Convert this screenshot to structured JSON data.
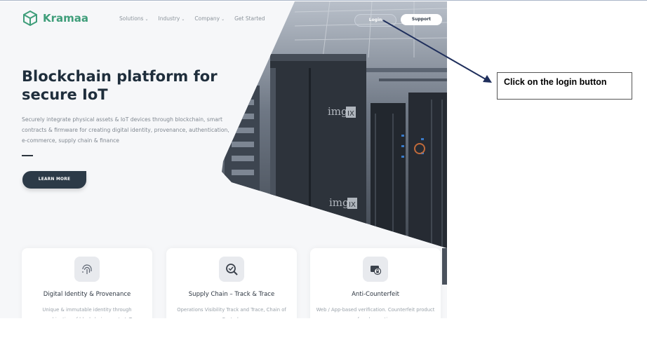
{
  "site": {
    "brand": "Kramaa",
    "nav": [
      {
        "label": "Solutions",
        "has_dropdown": true
      },
      {
        "label": "Industry",
        "has_dropdown": true
      },
      {
        "label": "Company",
        "has_dropdown": true
      },
      {
        "label": "Get Started",
        "has_dropdown": false
      }
    ],
    "login_label": "Login",
    "support_label": "Support",
    "hero": {
      "headline": "Blockchain platform for secure IoT",
      "subtext": "Securely integrate physical assets & IoT devices through blockchain, smart contracts & firmware for creating digital identity, provenance, authentication, e-commerce, supply chain & finance",
      "cta_label": "LEARN MORE",
      "image_watermark": "imgIX"
    },
    "cards": [
      {
        "title": "Digital Identity & Provenance",
        "desc": "Unique & immutable identity through combination of blockchain, crypto IoT",
        "icon": "fingerprint-icon"
      },
      {
        "title": "Supply Chain – Track & Trace",
        "desc": "Operations Visibility Track and Trace, Chain of Custody",
        "icon": "search-check-icon"
      },
      {
        "title": "Anti-Counterfeit",
        "desc": "Web / App-based verification. Counterfeit product fraud reporting",
        "icon": "shield-lock-icon"
      }
    ],
    "colors": {
      "brand": "#3f9e7a",
      "dark": "#2c3a47"
    }
  },
  "annotation": {
    "callout_text": "Click on the login button",
    "arrow_color": "#1f2f5c"
  }
}
